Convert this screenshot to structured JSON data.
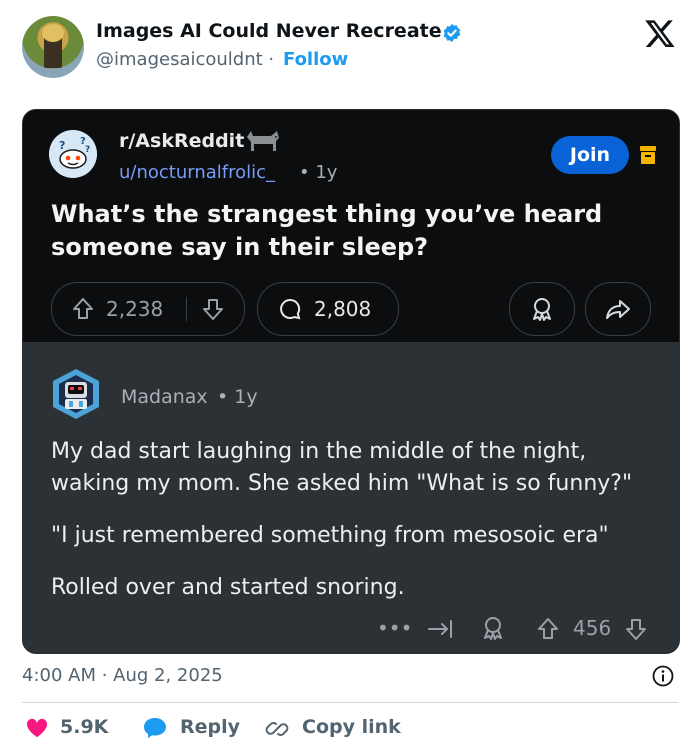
{
  "tweet": {
    "author_name": "Images AI Could Never Recreate",
    "handle": "@imagesaicouldnt",
    "separator": "·",
    "follow_label": "Follow",
    "timestamp": "4:00 AM · Aug 2, 2025"
  },
  "reddit_post": {
    "subreddit": "r/AskReddit",
    "username": "u/nocturnalfrolic_",
    "age": "• 1y",
    "join_label": "Join",
    "title": "What’s the strangest thing you’ve heard someone say in their sleep?",
    "upvotes": "2,238",
    "comments": "2,808"
  },
  "reddit_comment": {
    "username": "Madanax",
    "age": "• 1y",
    "paragraphs": [
      "My dad start laughing in the middle of the night, waking my mom. She asked him \"What is so funny?\"",
      "\"I just remembered something from mesosoic era\"",
      "Rolled over and started snoring."
    ],
    "more_label": "•••",
    "upvotes": "456"
  },
  "footer": {
    "likes": "5.9K",
    "reply_label": "Reply",
    "copy_link_label": "Copy link"
  },
  "colors": {
    "x_blue": "#1d9bf0",
    "like_red": "#f91880",
    "reddit_join": "#0a63d6",
    "card_bg": "#0b0d0f",
    "comment_bg": "#2c3136"
  }
}
